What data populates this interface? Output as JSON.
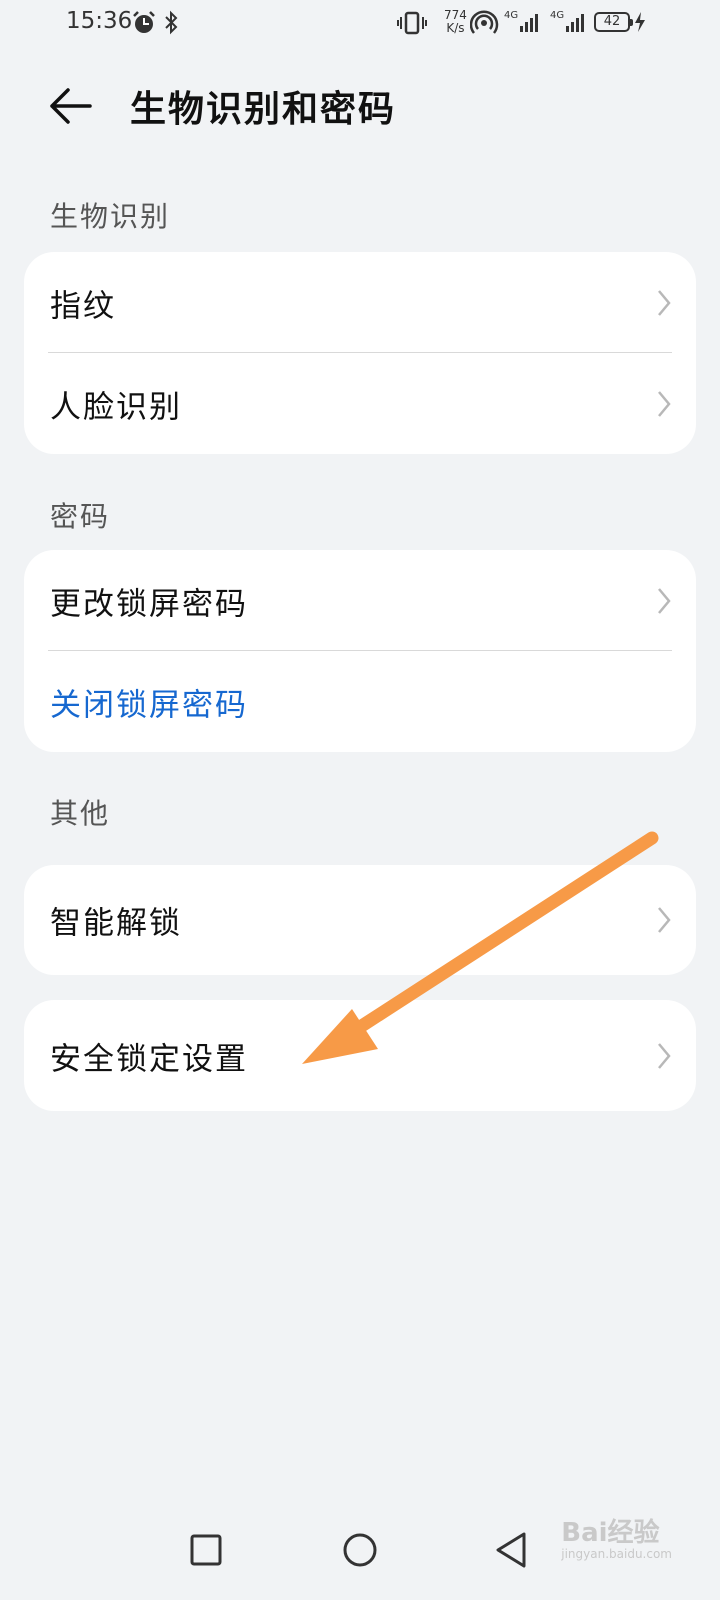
{
  "status_bar": {
    "time": "15:36",
    "net_speed_value": "774",
    "net_speed_unit": "K/s",
    "battery": "42",
    "icons": [
      "alarm-icon",
      "bluetooth-icon",
      "vibrate-icon",
      "hotspot-icon",
      "signal-4g-icon",
      "signal-4g-icon",
      "battery-icon",
      "charging-icon"
    ]
  },
  "header": {
    "title": "生物识别和密码",
    "back_icon": "back-arrow-icon"
  },
  "sections": {
    "biometrics": {
      "label": "生物识别",
      "items": [
        "指纹",
        "人脸识别"
      ]
    },
    "password": {
      "label": "密码",
      "items": [
        "更改锁屏密码",
        "关闭锁屏密码"
      ]
    },
    "other": {
      "label": "其他",
      "items": [
        "智能解锁",
        "安全锁定设置"
      ]
    }
  },
  "colors": {
    "background": "#f1f3f5",
    "card": "#ffffff",
    "accent_blue": "#1668d0",
    "annotation_arrow": "#f79a47"
  },
  "nav_bar": {
    "icons": [
      "recents-square-icon",
      "home-circle-icon",
      "back-triangle-icon"
    ]
  },
  "watermark": {
    "text": "Bai经验",
    "sub": "jingyan.baidu.com"
  }
}
